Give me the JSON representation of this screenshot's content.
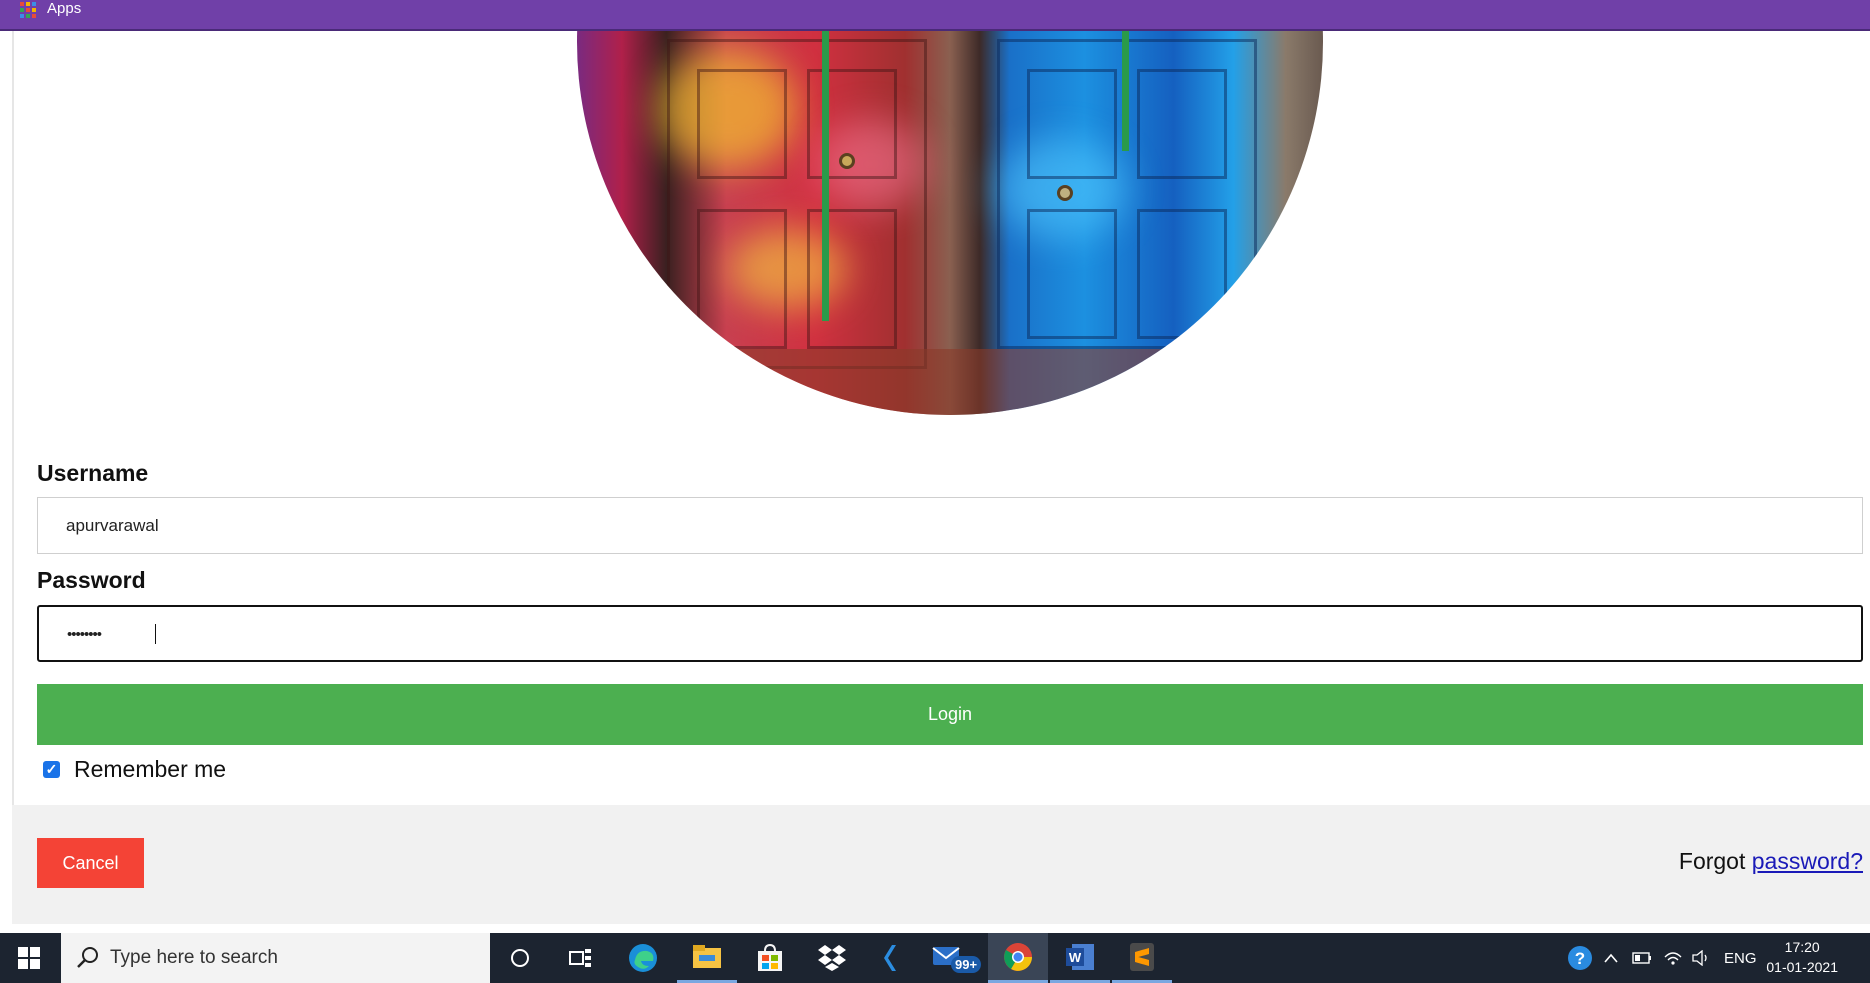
{
  "browser": {
    "apps_label": "Apps"
  },
  "form": {
    "username_label": "Username",
    "username_value": "apurvarawal",
    "password_label": "Password",
    "password_masked": "••••••••",
    "login_label": "Login",
    "remember_label": "Remember me",
    "remember_checked": true,
    "cancel_label": "Cancel",
    "forgot_prefix": "Forgot",
    "forgot_link": "password?"
  },
  "colors": {
    "apps_bar": "#7040a8",
    "login_button": "#4caf50",
    "cancel_button": "#f44336",
    "link": "#1a1ab8",
    "taskbar": "#1c2430"
  },
  "taskbar": {
    "search_placeholder": "Type here to search",
    "pinned": [
      {
        "name": "cortana-icon"
      },
      {
        "name": "task-view-icon"
      },
      {
        "name": "edge-icon"
      },
      {
        "name": "file-explorer-icon"
      },
      {
        "name": "store-icon"
      },
      {
        "name": "dropbox-icon"
      },
      {
        "name": "visual-studio-icon"
      },
      {
        "name": "mail-icon",
        "badge": "99+"
      },
      {
        "name": "chrome-icon"
      },
      {
        "name": "word-icon"
      },
      {
        "name": "sublime-icon"
      }
    ],
    "tray": {
      "language": "ENG",
      "time": "17:20",
      "date": "01-01-2021"
    }
  }
}
